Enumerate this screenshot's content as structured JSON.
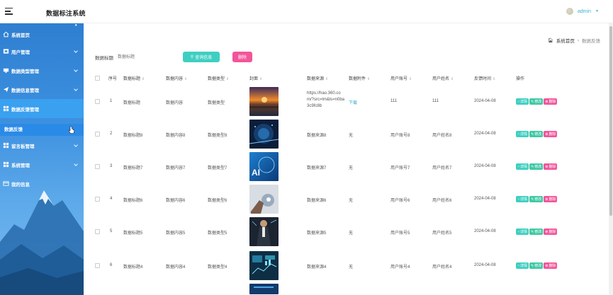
{
  "header": {
    "title": "数据标注系统",
    "username": "admin"
  },
  "sidebar": {
    "items": [
      {
        "label": "系统首页",
        "icon": "home-icon"
      },
      {
        "label": "用户管理",
        "icon": "user-icon"
      },
      {
        "label": "数据类型管理",
        "icon": "tag-icon"
      },
      {
        "label": "数据信息管理",
        "icon": "paper-plane-icon"
      },
      {
        "label": "数据反馈管理",
        "icon": "grid-icon"
      },
      {
        "label": "留言板管理",
        "icon": "grid-icon"
      },
      {
        "label": "系统管理",
        "icon": "grid-icon"
      },
      {
        "label": "我的信息",
        "icon": "card-icon"
      }
    ],
    "submenu": {
      "label": "数据反馈"
    }
  },
  "breadcrumb": {
    "home": "系统首页",
    "separator": "›",
    "current": "数据反馈"
  },
  "search": {
    "label": "数据标题",
    "placeholder": "数据标题",
    "query_button": "查询信息",
    "delete_button": "删除"
  },
  "table": {
    "columns": [
      "序号",
      "数据标题",
      "数据内容",
      "数据类型",
      "封面",
      "数据来源",
      "数据附件",
      "用户账号",
      "用户姓名",
      "反馈时间",
      "操作"
    ],
    "actions": {
      "detail": "详情",
      "edit": "修改",
      "delete": "删除"
    },
    "rows": [
      {
        "index": "1",
        "title": "数据标题",
        "content": "数据内容",
        "type": "数据类型",
        "cover": "sunset",
        "source": "https://hao.360.com/?src=lm&ls=n0ba3c9fc8b",
        "attachment": "下载",
        "account": "111",
        "name": "111",
        "time": "2024-04-08"
      },
      {
        "index": "2",
        "title": "数据标题8",
        "content": "数据内容8",
        "type": "数据类型8",
        "cover": "tech-blue",
        "source": "数据来源8",
        "attachment": "无",
        "account": "用户账号8",
        "name": "用户姓名8",
        "time": "2024-04-08"
      },
      {
        "index": "3",
        "title": "数据标题7",
        "content": "数据内容7",
        "type": "数据类型7",
        "cover": "ai",
        "source": "数据来源7",
        "attachment": "无",
        "account": "用户账号7",
        "name": "用户姓名7",
        "time": "2024-04-08"
      },
      {
        "index": "4",
        "title": "数据标题6",
        "content": "数据内容6",
        "type": "数据类型6",
        "cover": "hand",
        "source": "数据来源6",
        "attachment": "无",
        "account": "用户账号6",
        "name": "用户姓名6",
        "time": "2024-04-08"
      },
      {
        "index": "5",
        "title": "数据标题5",
        "content": "数据内容5",
        "type": "数据类型5",
        "cover": "business",
        "source": "数据来源5",
        "attachment": "无",
        "account": "用户账号5",
        "name": "用户姓名5",
        "time": "2024-04-08"
      },
      {
        "index": "6",
        "title": "数据标题4",
        "content": "数据内容4",
        "type": "数据类型4",
        "cover": "dashboard",
        "source": "数据来源4",
        "attachment": "无",
        "account": "用户账号4",
        "name": "用户姓名4",
        "time": "2024-04-08"
      }
    ]
  },
  "colors": {
    "sidebar_top": "#2f7fd1",
    "accent_teal": "#3fcfc1",
    "accent_pink": "#f2559a",
    "active_item": "#3aa0f0"
  }
}
